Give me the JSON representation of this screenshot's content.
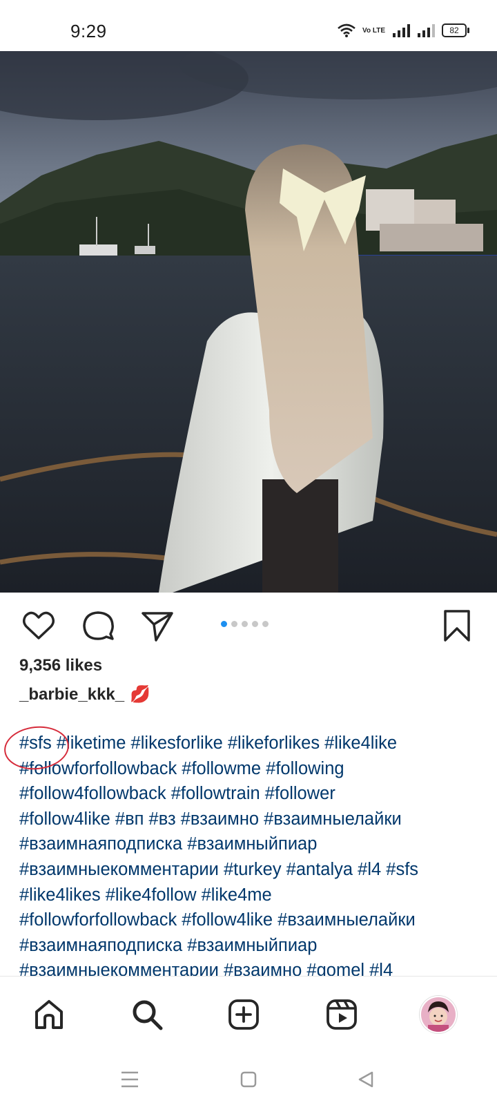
{
  "status_bar": {
    "time": "9:29",
    "network_label": "Vo LTE",
    "battery_level": "82"
  },
  "post": {
    "image_alt": "Woman with long blonde hair and a white bow looking at a harbor at dusk",
    "carousel": {
      "count": 5,
      "active_index": 0
    },
    "likes": "9,356 likes",
    "username": "_barbie_kkk_",
    "username_emoji": "💋",
    "caption_lines": [
      "#sfs #liketime #likesforlike #likeforlikes #like4like",
      "#followforfollowback #followme #following",
      "#follow4followback #followtrain #follower",
      "#follow4like #вп #вз #взаимно #взаимныелайки",
      "#взаимнаяподписка #взаимныйпиар",
      "#взаимныекомментарии #turkey #antalya #l4 #sfs",
      "#like4likes #like4follow #like4me",
      "#followforfollowback #follow4like #взаимныелайки",
      "#взаимнаяподписка #взаимныйпиар",
      "#взаимныекомментарии #взаимно #gomel #l4"
    ]
  },
  "actions": {
    "like": "heart-icon",
    "comment": "comment-icon",
    "share": "share-icon",
    "save": "bookmark-icon"
  },
  "bottom_nav": [
    "home-icon",
    "search-icon",
    "create-icon",
    "reels-icon",
    "profile-avatar"
  ],
  "colors": {
    "hashtag": "#00376b",
    "carousel_active": "#1d8ff0",
    "annotation_circle": "#d62b3a"
  }
}
